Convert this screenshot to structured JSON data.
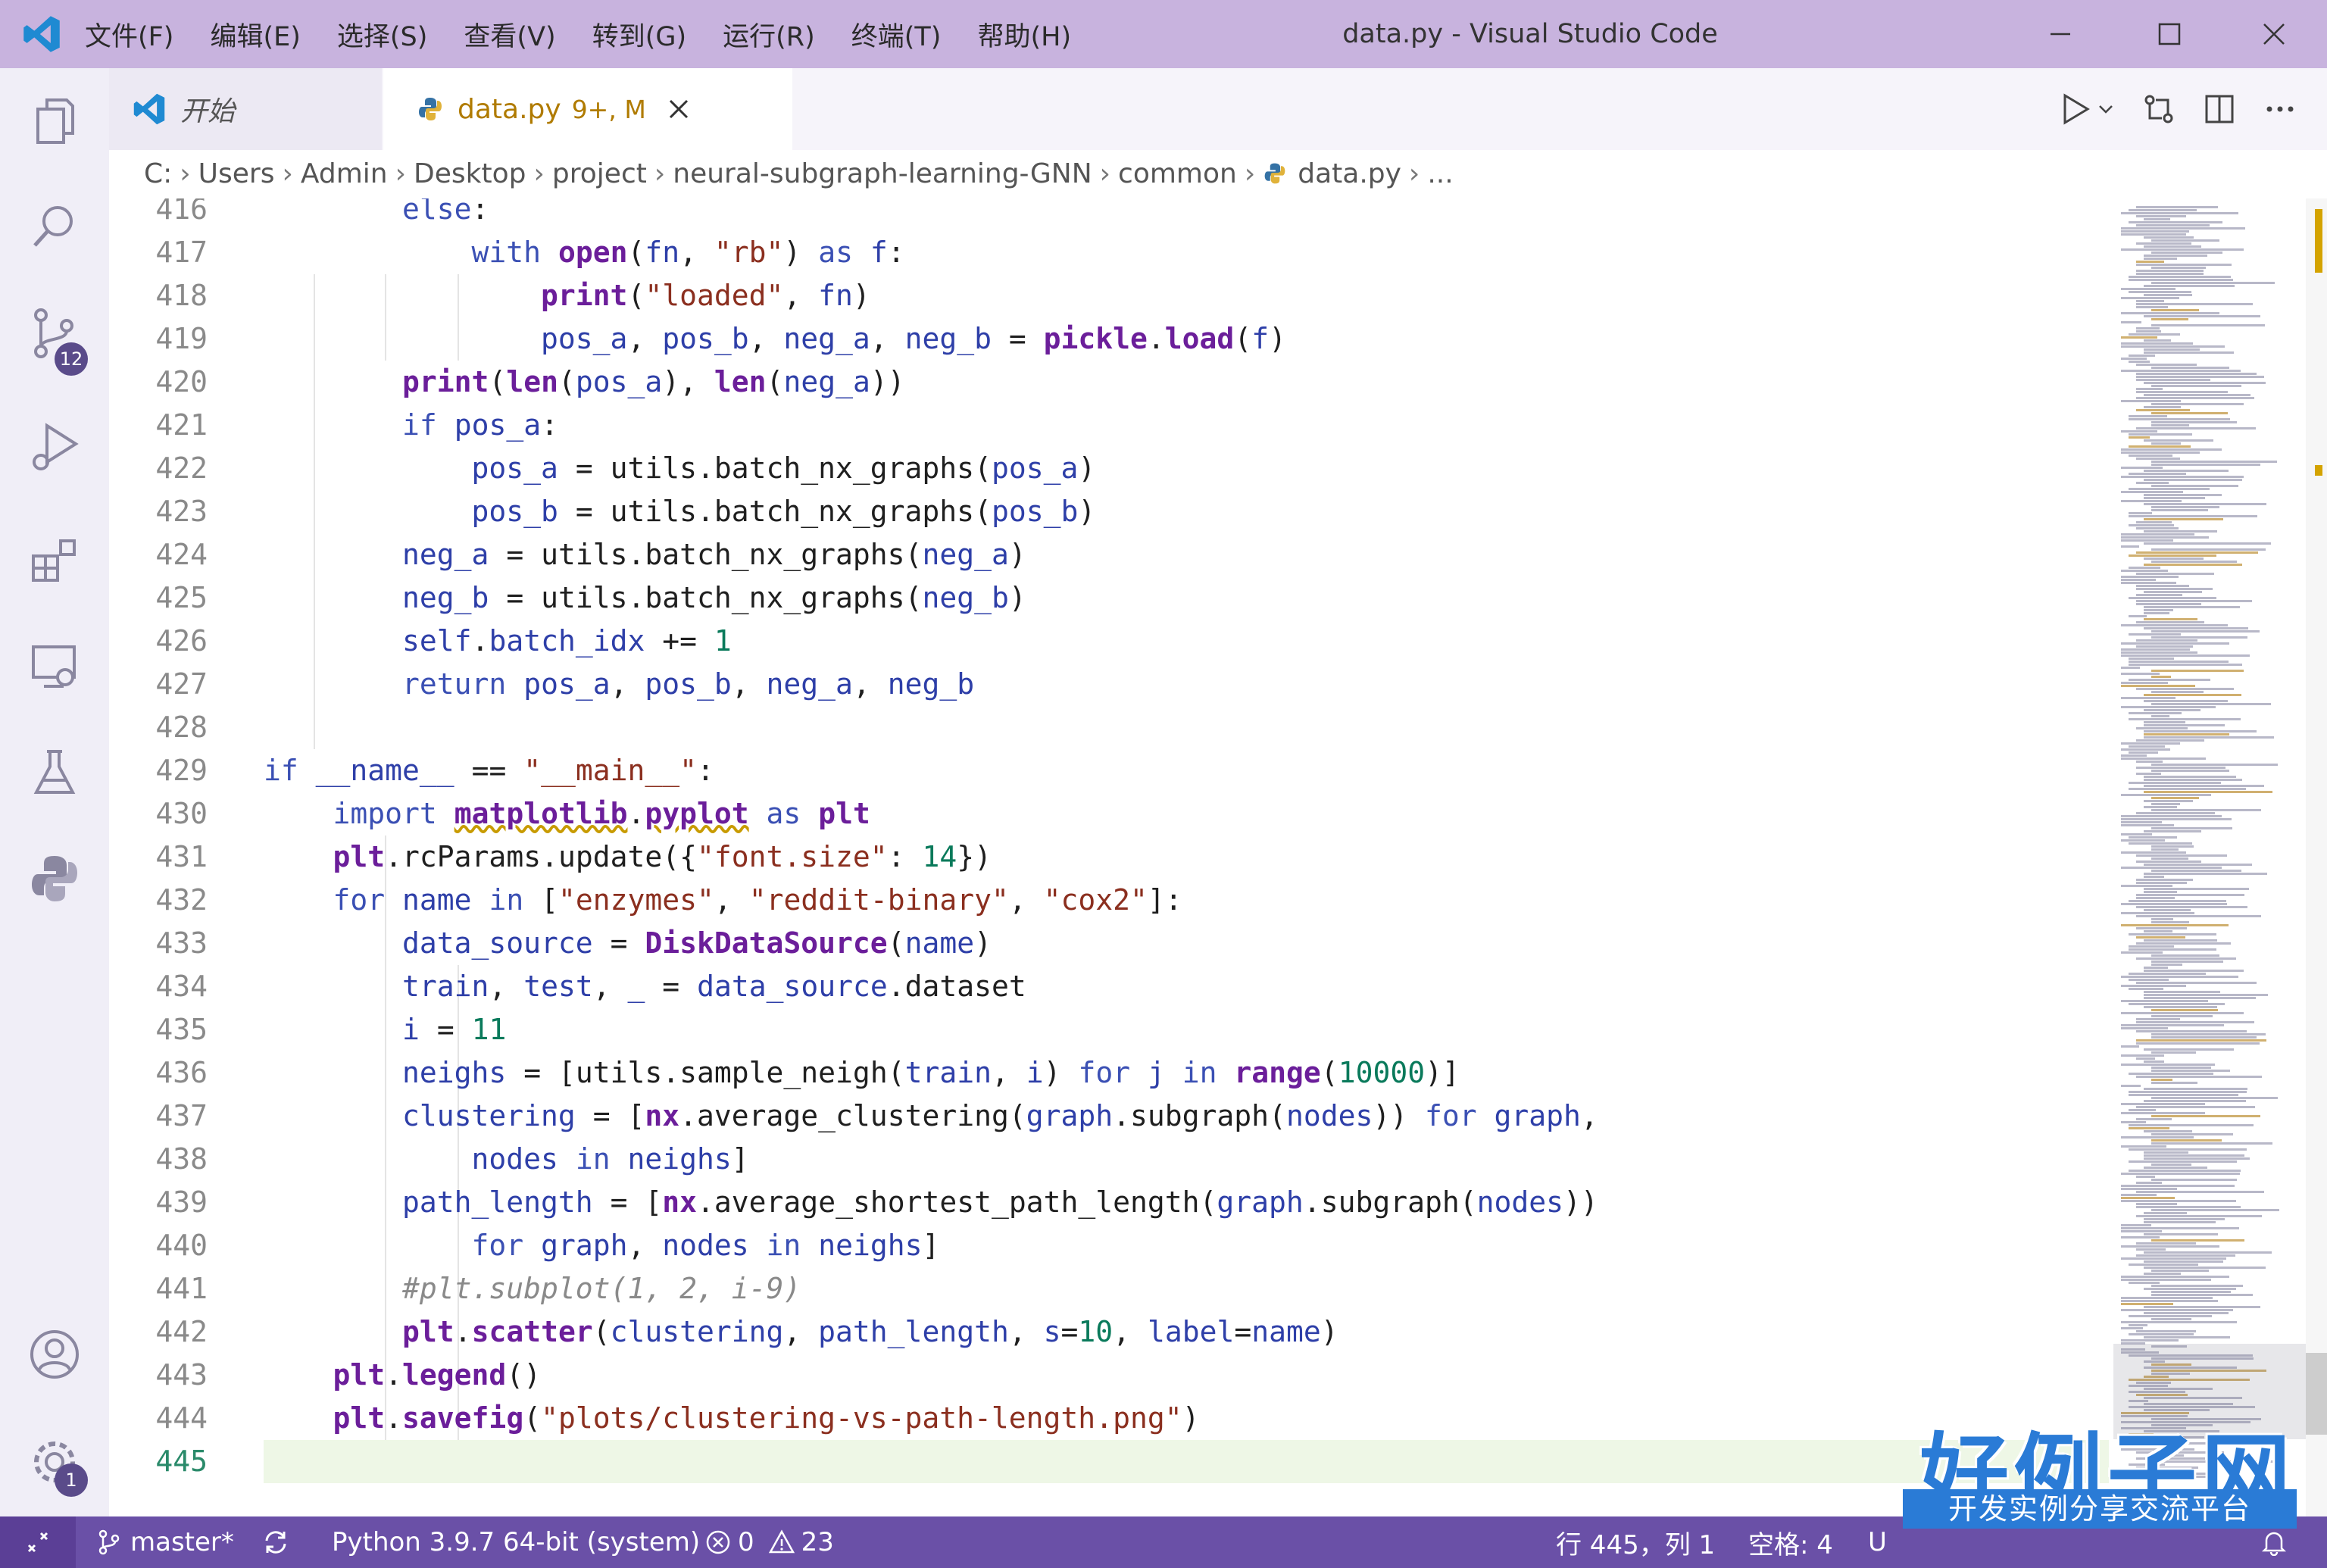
{
  "titlebar": {
    "menu": [
      "文件(F)",
      "编辑(E)",
      "选择(S)",
      "查看(V)",
      "转到(G)",
      "运行(R)",
      "终端(T)",
      "帮助(H)"
    ],
    "window_title": "data.py - Visual Studio Code"
  },
  "activity_bar": {
    "scm_badge": "12",
    "settings_badge": "1"
  },
  "tabs": [
    {
      "label": "开始",
      "status": ""
    },
    {
      "label": "data.py",
      "status": "9+, M"
    }
  ],
  "breadcrumb": [
    "C:",
    "Users",
    "Admin",
    "Desktop",
    "project",
    "neural-subgraph-learning-GNN",
    "common",
    "data.py",
    "..."
  ],
  "editor": {
    "lines": [
      {
        "n": "416",
        "code": "        else:"
      },
      {
        "n": "417",
        "code": "            with open(fn, \"rb\") as f:"
      },
      {
        "n": "418",
        "code": "                print(\"loaded\", fn)"
      },
      {
        "n": "419",
        "code": "                pos_a, pos_b, neg_a, neg_b = pickle.load(f)"
      },
      {
        "n": "420",
        "code": "        print(len(pos_a), len(neg_a))"
      },
      {
        "n": "421",
        "code": "        if pos_a:"
      },
      {
        "n": "422",
        "code": "            pos_a = utils.batch_nx_graphs(pos_a)"
      },
      {
        "n": "423",
        "code": "            pos_b = utils.batch_nx_graphs(pos_b)"
      },
      {
        "n": "424",
        "code": "        neg_a = utils.batch_nx_graphs(neg_a)"
      },
      {
        "n": "425",
        "code": "        neg_b = utils.batch_nx_graphs(neg_b)"
      },
      {
        "n": "426",
        "code": "        self.batch_idx += 1"
      },
      {
        "n": "427",
        "code": "        return pos_a, pos_b, neg_a, neg_b"
      },
      {
        "n": "428",
        "code": ""
      },
      {
        "n": "429",
        "code": "if __name__ == \"__main__\":"
      },
      {
        "n": "430",
        "code": "    import matplotlib.pyplot as plt"
      },
      {
        "n": "431",
        "code": "    plt.rcParams.update({\"font.size\": 14})"
      },
      {
        "n": "432",
        "code": "    for name in [\"enzymes\", \"reddit-binary\", \"cox2\"]:"
      },
      {
        "n": "433",
        "code": "        data_source = DiskDataSource(name)"
      },
      {
        "n": "434",
        "code": "        train, test, _ = data_source.dataset"
      },
      {
        "n": "435",
        "code": "        i = 11"
      },
      {
        "n": "436",
        "code": "        neighs = [utils.sample_neigh(train, i) for j in range(10000)]"
      },
      {
        "n": "437",
        "code": "        clustering = [nx.average_clustering(graph.subgraph(nodes)) for graph,"
      },
      {
        "n": "438",
        "code": "            nodes in neighs]"
      },
      {
        "n": "439",
        "code": "        path_length = [nx.average_shortest_path_length(graph.subgraph(nodes))"
      },
      {
        "n": "440",
        "code": "            for graph, nodes in neighs]"
      },
      {
        "n": "441",
        "code": "        #plt.subplot(1, 2, i-9)"
      },
      {
        "n": "442",
        "code": "        plt.scatter(clustering, path_length, s=10, label=name)"
      },
      {
        "n": "443",
        "code": "    plt.legend()"
      },
      {
        "n": "444",
        "code": "    plt.savefig(\"plots/clustering-vs-path-length.png\")"
      },
      {
        "n": "445",
        "code": ""
      }
    ]
  },
  "statusbar": {
    "branch": "master*",
    "python": "Python 3.9.7 64-bit (system)",
    "errors": "0",
    "warnings": "23",
    "position": "行 445，列 1",
    "spaces": "空格: 4",
    "encoding_fragment": "U"
  },
  "watermark": {
    "title": "好例子网",
    "subtitle": "开发实例分享交流平台"
  },
  "colors": {
    "titlebar": "#c8b3de",
    "statusbar": "#6a50a7",
    "accent": "#5a4b8a",
    "current_line": "#eef7e6"
  }
}
